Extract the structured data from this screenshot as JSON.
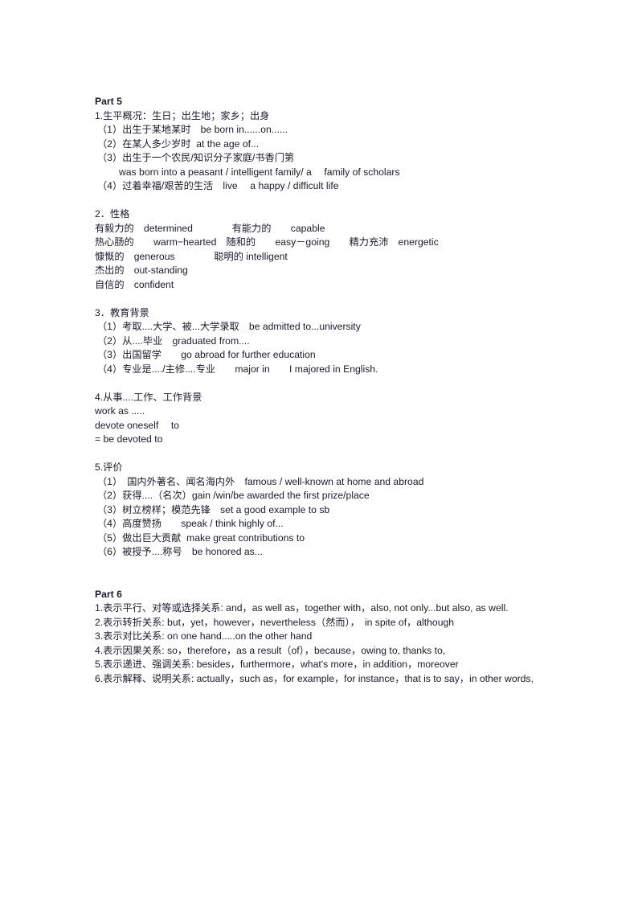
{
  "document": {
    "part5": {
      "heading": "Part 5",
      "sections": [
        {
          "title": "1.生平概况：生日；出生地；家乡；出身",
          "items": [
            "（1）出生于某地某时　be born in......on......",
            "（2）在某人多少岁时  at the age of...",
            "（3）出生于一个农民/知识分子家庭/书香门第",
            "was born into a peasant / intelligent family/ a 　family of scholars",
            "（4）过着幸福/艰苦的生活　live 　a happy / difficult life"
          ]
        },
        {
          "title": "2．性格",
          "items": [
            "有毅力的　determined　　　　有能力的　　capable",
            "热心肠的　　warm−hearted　随和的　　easy－going　　精力充沛　energetic",
            "慷慨的　generous　　　　聪明的 intelligent",
            "杰出的　out-standing",
            "自信的　confident"
          ]
        },
        {
          "title": "3．教育背景",
          "items": [
            "（1）考取....大学、被...大学录取　be admitted to...university",
            "（2）从....毕业　graduated from....",
            "（3）出国留学　　go abroad for further education",
            "（4）专业是..../主修....专业　　major in　　I majored in English."
          ]
        },
        {
          "title": "4.从事....工作、工作背景",
          "items": [
            "work as .....",
            "devote oneself 　to",
            "= be devoted to"
          ]
        },
        {
          "title": "5.评价",
          "items": [
            "（1）　国内外著名、闻名海内外　famous / well-known at home and abroad",
            "（2）获得....（名次）gain /win/be awarded the first prize/place",
            "（3）树立榜样；模范先锋　set a good example to sb",
            "（4）高度赞扬　　speak / think highly of...",
            "（5）做出巨大贡献  make great contributions to",
            "（6）被授予....称号　be honored as..."
          ]
        }
      ]
    },
    "part6": {
      "heading": "Part 6",
      "lines": [
        "1.表示平行、对等或选择关系: and，as well as，together with，also, not only...but also, as well.",
        "2.表示转折关系: but，yet，however，nevertheless（然而），　in spite of，although",
        "3.表示对比关系: on one hand.....on the other hand",
        "4.表示因果关系: so，therefore，as a result（of），because，owing to, thanks to,",
        "5.表示递进、强调关系: besides，furthermore，what's more，in addition，moreover",
        "6.表示解释、说明关系: actually，such as，for example，for instance，that is to say，in other words,"
      ]
    }
  }
}
